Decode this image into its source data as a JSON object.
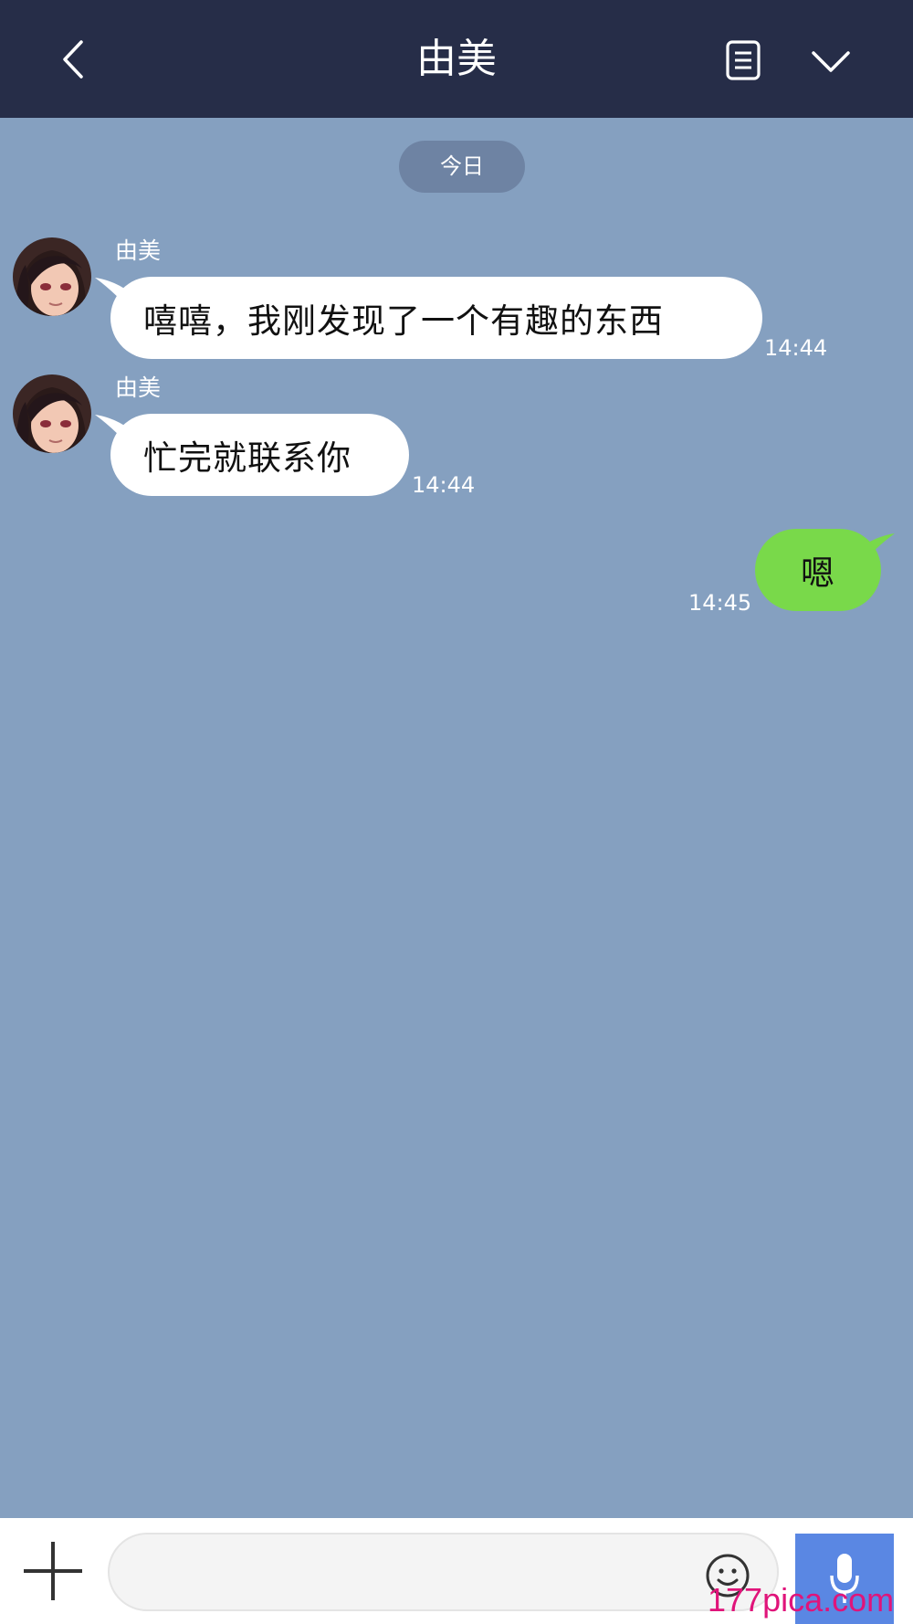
{
  "header": {
    "title": "由美",
    "back_icon": "chevron-left-icon",
    "notes_icon": "notes-icon",
    "menu_icon": "chevron-down-icon",
    "background": "#262d48"
  },
  "date_separator": "今日",
  "messages": [
    {
      "direction": "incoming",
      "sender": "由美",
      "text": "嘻嘻，我刚发现了一个有趣的东西",
      "time": "14:44"
    },
    {
      "direction": "incoming",
      "sender": "由美",
      "text": "忙完就联系你",
      "time": "14:44"
    },
    {
      "direction": "outgoing",
      "text": "嗯",
      "time": "14:45"
    }
  ],
  "input_bar": {
    "value": "",
    "placeholder": "",
    "plus_icon": "plus-icon",
    "emoji_icon": "smiley-icon",
    "mic_icon": "microphone-icon"
  },
  "watermark": "177pica.com",
  "colors": {
    "chat_background": "#85a0c0",
    "incoming_bubble": "#ffffff",
    "outgoing_bubble": "#79d94a",
    "mic_button": "#5a87e3"
  }
}
